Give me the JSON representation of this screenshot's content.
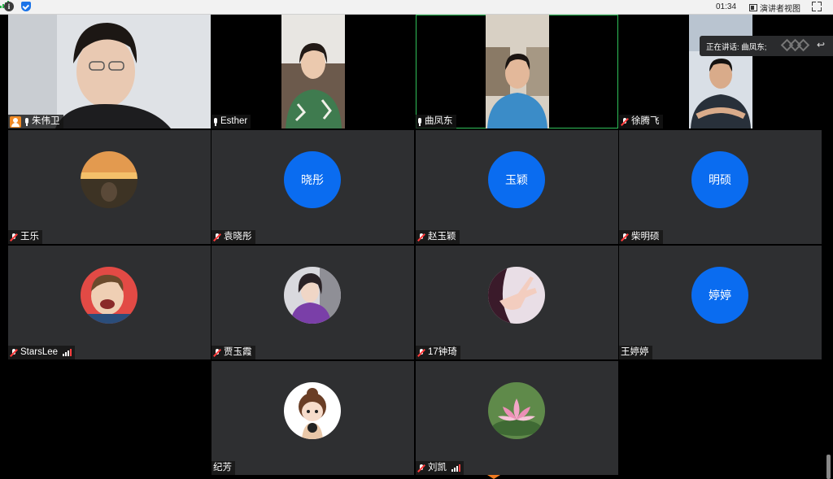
{
  "app": {
    "timer": "01:34",
    "view_button": "演讲者视图",
    "speaking_prefix": "正在讲话: 曲凤东;"
  },
  "participants": [
    {
      "name": "朱伟卫",
      "type": "video",
      "host": true
    },
    {
      "name": "Esther",
      "type": "video"
    },
    {
      "name": "曲凤东",
      "type": "video",
      "speaking": true
    },
    {
      "name": "徐腾飞",
      "type": "video"
    },
    {
      "name": "王乐",
      "type": "avatar-photo"
    },
    {
      "name": "袁晓彤",
      "type": "avatar-text",
      "avatar_text": "晓彤"
    },
    {
      "name": "赵玉颖",
      "type": "avatar-text",
      "avatar_text": "玉颖"
    },
    {
      "name": "柴明硕",
      "type": "avatar-text",
      "avatar_text": "明硕"
    },
    {
      "name": "StarsLee",
      "type": "avatar-photo"
    },
    {
      "name": "贾玉霞",
      "type": "avatar-photo"
    },
    {
      "name": "17钟琦",
      "type": "avatar-photo"
    },
    {
      "name": "王婷婷",
      "type": "avatar-text",
      "avatar_text": "婷婷"
    },
    {
      "name": "纪芳",
      "type": "avatar-photo"
    },
    {
      "name": "刘凯",
      "type": "avatar-photo"
    }
  ],
  "colors": {
    "avatar_blue": "#0a6cf0",
    "tile_bg": "#2e2f31",
    "active_border": "#2fbf59",
    "host_badge": "#f08a24"
  }
}
